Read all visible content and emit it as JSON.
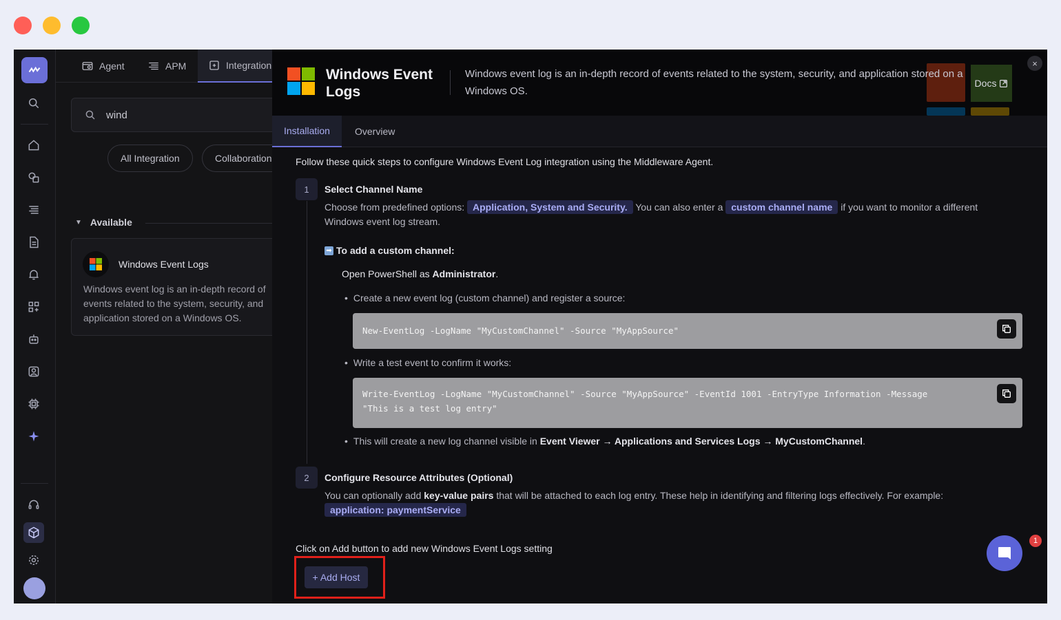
{
  "colors": {
    "red": "#ff5f57",
    "yellow": "#febc2e",
    "green": "#28c840",
    "accent": "#6b6fd8",
    "highlight": "#e0201a"
  },
  "top_tabs": [
    {
      "label": "Agent",
      "icon": "agent-icon"
    },
    {
      "label": "APM",
      "icon": "apm-icon"
    },
    {
      "label": "Integration",
      "icon": "integration-icon"
    }
  ],
  "search": {
    "value": "wind"
  },
  "filters": [
    "All Integration",
    "Collaboration"
  ],
  "section": {
    "label": "Available"
  },
  "card": {
    "title": "Windows Event Logs",
    "desc_lines": [
      "Windows event log is an in-depth record of",
      "events related to the system, security, and",
      "application stored on a Windows OS."
    ]
  },
  "header": {
    "title": "Windows Event Logs",
    "desc": "Windows event log is an in-depth record of events related to the system, security, and application stored on a Windows OS.",
    "docs_label": "Docs",
    "close_label": "×"
  },
  "tabs": [
    {
      "label": "Installation"
    },
    {
      "label": "Overview"
    }
  ],
  "intro": "Follow these quick steps to configure Windows Event Log integration using the Middleware Agent.",
  "step1": {
    "num": "1",
    "title": "Select Channel Name",
    "p1_a": "Choose from predefined options:",
    "p1_hl1": "Application, System and Security.",
    "p1_b": "You can also enter a",
    "p1_hl2": "custom channel name",
    "p1_c": "if you want to monitor a different",
    "p1_line2": "Windows event log stream.",
    "custom_title": "To add a custom channel:",
    "open_a": "Open PowerShell as ",
    "open_b": "Administrator",
    "open_c": ".",
    "bullet1": "Create a new event log (custom channel) and register a source:",
    "code1": "New-EventLog -LogName \"MyCustomChannel\" -Source \"MyAppSource\"",
    "bullet2": "Write a test event to confirm it works:",
    "code2_line1": "Write-EventLog -LogName \"MyCustomChannel\" -Source \"MyAppSource\" -EventId 1001 -EntryType Information -Message",
    "code2_line2": "\"This is a test log entry\"",
    "bullet3_a": "This will create a new log channel visible in ",
    "bullet3_b": "Event Viewer → Applications and Services Logs → MyCustomChannel",
    "bullet3_c": "."
  },
  "step2": {
    "num": "2",
    "title": "Configure Resource Attributes (Optional)",
    "p_a": "You can optionally add ",
    "p_b": "key-value pairs",
    "p_c": " that will be attached to each log entry. These help in identifying and filtering logs effectively. For example:",
    "example": "application: paymentService"
  },
  "add_prompt": "Click on Add button to add new Windows Event Logs setting",
  "add_button": "+ Add Host",
  "chat_badge": "1"
}
